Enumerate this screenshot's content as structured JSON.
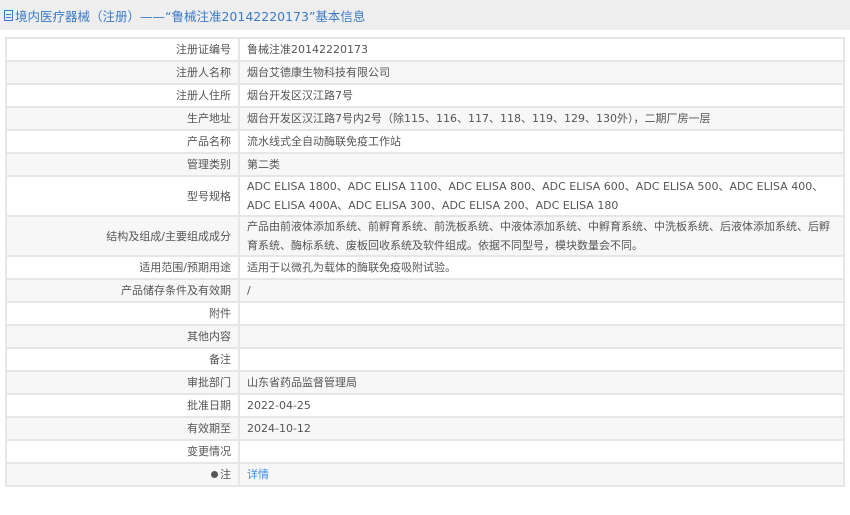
{
  "header": {
    "title": "境内医疗器械（注册）——“鲁械注准20142220173”基本信息"
  },
  "rows": [
    {
      "label": "注册证编号",
      "value": "鲁械注准20142220173"
    },
    {
      "label": "注册人名称",
      "value": "烟台艾德康生物科技有限公司"
    },
    {
      "label": "注册人住所",
      "value": "烟台开发区汉江路7号"
    },
    {
      "label": "生产地址",
      "value": "烟台开发区汉江路7号内2号（除115、116、117、118、119、129、130外），二期厂房一层"
    },
    {
      "label": "产品名称",
      "value": "流水线式全自动酶联免疫工作站"
    },
    {
      "label": "管理类别",
      "value": "第二类"
    },
    {
      "label": "型号规格",
      "value": "ADC ELISA 1800、ADC ELISA 1100、ADC ELISA 800、ADC ELISA 600、ADC ELISA 500、ADC ELISA 400、ADC ELISA 400A、ADC ELISA 300、ADC ELISA 200、ADC ELISA 180"
    },
    {
      "label": "结构及组成/主要组成成分",
      "value": "产品由前液体添加系统、前孵育系统、前洗板系统、中液体添加系统、中孵育系统、中洗板系统、后液体添加系统、后孵育系统、酶标系统、废板回收系统及软件组成。依据不同型号，模块数量会不同。"
    },
    {
      "label": "适用范围/预期用途",
      "value": "适用于以微孔为载体的酶联免疫吸附试验。"
    },
    {
      "label": "产品储存条件及有效期",
      "value": "/"
    },
    {
      "label": "附件",
      "value": ""
    },
    {
      "label": "其他内容",
      "value": ""
    },
    {
      "label": "备注",
      "value": ""
    },
    {
      "label": "审批部门",
      "value": "山东省药品监督管理局"
    },
    {
      "label": "批准日期",
      "value": "2022-04-25"
    },
    {
      "label": "有效期至",
      "value": "2024-10-12"
    },
    {
      "label": "变更情况",
      "value": ""
    }
  ],
  "note": {
    "label": "注",
    "link": "详情"
  }
}
